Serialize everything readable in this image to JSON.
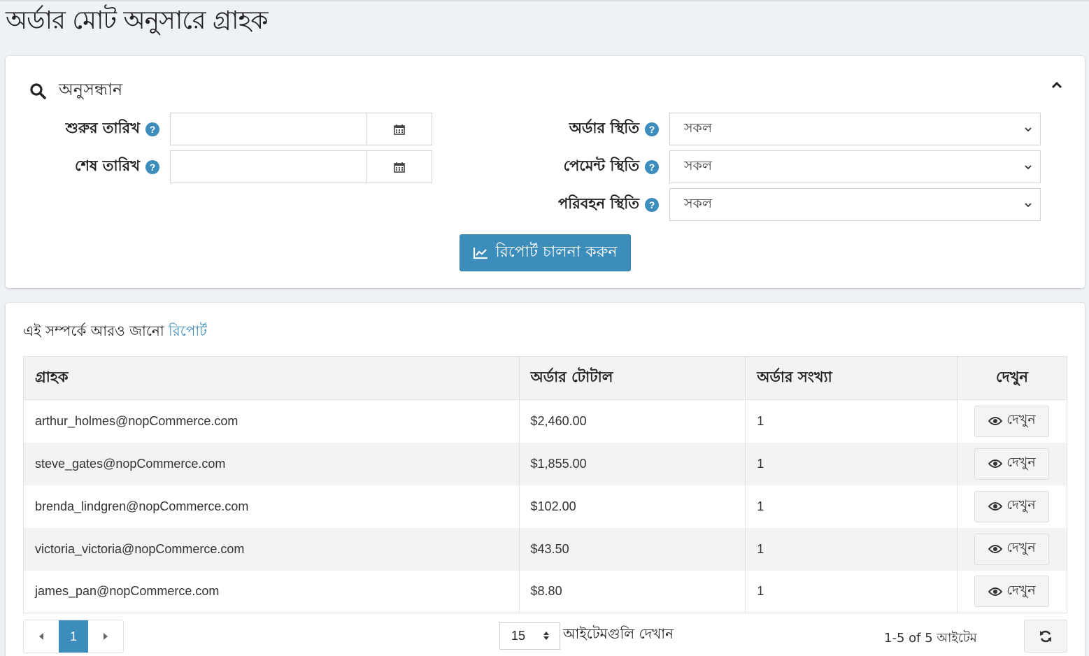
{
  "page": {
    "title": "অর্ডার মোট অনুসারে গ্রাহক"
  },
  "search": {
    "title": "অনুসন্ধান",
    "start_date_label": "শুরুর তারিখ",
    "end_date_label": "শেষ তারিখ",
    "start_date_value": "",
    "end_date_value": "",
    "order_status_label": "অর্ডার স্থিতি",
    "payment_status_label": "পেমেন্ট স্থিতি",
    "shipping_status_label": "পরিবহন স্থিতি",
    "order_status_value": "সকল",
    "payment_status_value": "সকল",
    "shipping_status_value": "সকল",
    "help_glyph": "?",
    "run_button": "রিপোর্ট চালনা করুন"
  },
  "results": {
    "learn_more_prefix": "এই সম্পর্কে আরও জানো",
    "learn_more_link": "রিপোর্ট",
    "columns": [
      "গ্রাহক",
      "অর্ডার টোটাল",
      "অর্ডার সংখ্যা",
      "দেখুন"
    ],
    "rows": [
      {
        "customer": "arthur_holmes@nopCommerce.com",
        "total": "$2,460.00",
        "count": "1",
        "view": "দেখুন"
      },
      {
        "customer": "steve_gates@nopCommerce.com",
        "total": "$1,855.00",
        "count": "1",
        "view": "দেখুন"
      },
      {
        "customer": "brenda_lindgren@nopCommerce.com",
        "total": "$102.00",
        "count": "1",
        "view": "দেখুন"
      },
      {
        "customer": "victoria_victoria@nopCommerce.com",
        "total": "$43.50",
        "count": "1",
        "view": "দেখুন"
      },
      {
        "customer": "james_pan@nopCommerce.com",
        "total": "$8.80",
        "count": "1",
        "view": "দেখুন"
      }
    ]
  },
  "pager": {
    "current_page": "1",
    "page_size": "15",
    "page_size_label": "আইটেমগুলি দেখান",
    "info": "1-5 of 5 আইটেম"
  },
  "colors": {
    "accent": "#3c8dbc",
    "background": "#eef1f5"
  }
}
